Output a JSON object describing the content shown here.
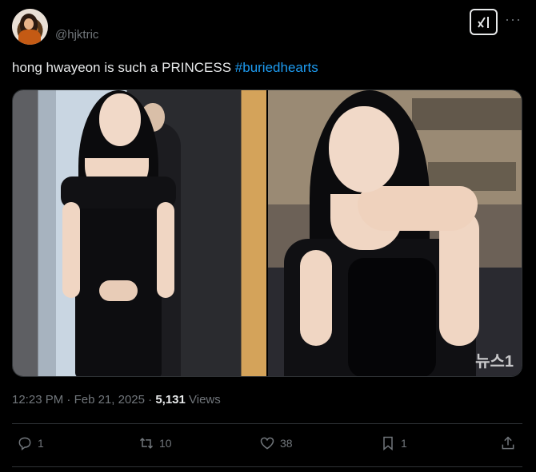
{
  "author": {
    "handle": "@hjktric"
  },
  "header": {
    "grok_icon": "grok-icon",
    "more_icon": "more-icon",
    "more_label": "···"
  },
  "tweet": {
    "text": "hong hwayeon is such a PRINCESS",
    "hashtag": "#buriedhearts",
    "hashtag_color": "#1d9bf0"
  },
  "media": {
    "watermark": "뉴스1"
  },
  "meta": {
    "time": "12:23 PM",
    "separator1": " · ",
    "date": "Feb 21, 2025",
    "separator2": " · ",
    "views_count": "5,131",
    "views_label": " Views"
  },
  "actions": {
    "reply_count": "1",
    "retweet_count": "10",
    "like_count": "38",
    "bookmark_count": "1"
  },
  "colors": {
    "background": "#000000",
    "text": "#e7e9ea",
    "muted": "#71767b",
    "accent": "#1d9bf0",
    "border": "#2f3336"
  }
}
